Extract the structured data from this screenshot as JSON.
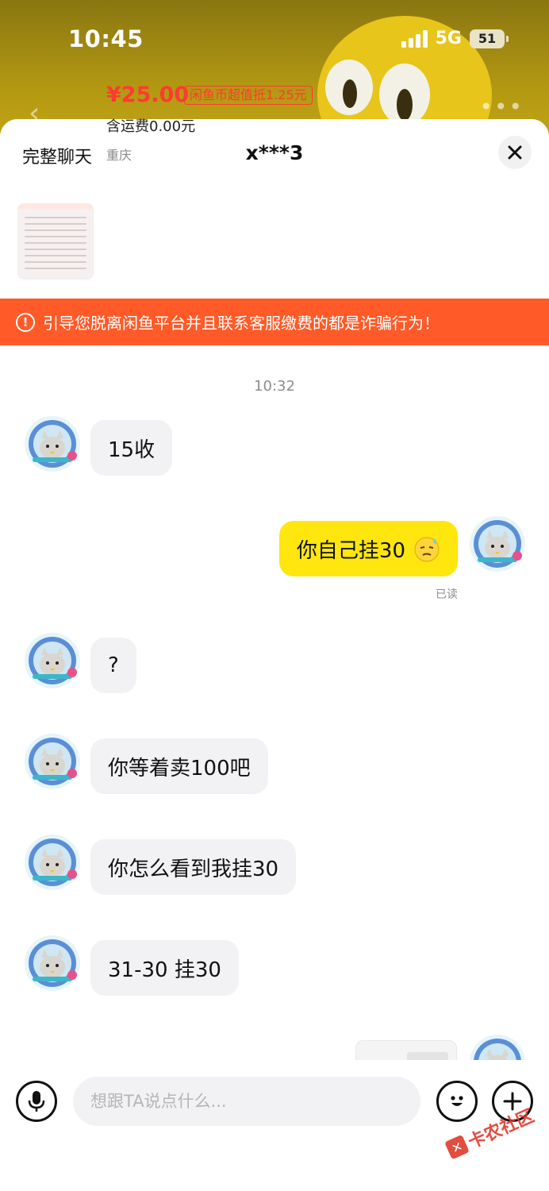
{
  "status_bar": {
    "time": "10:45",
    "network": "5G",
    "battery": "51"
  },
  "header": {
    "full_chat_label": "完整聊天",
    "peer_name": "x***3"
  },
  "product": {
    "price": "¥25.00",
    "coin_badge": "闲鱼币超值抵1.25元",
    "shipping": "含运费0.00元",
    "location": "重庆"
  },
  "warning": {
    "text": "引导您脱离闲鱼平台并且联系客服缴费的都是诈骗行为！"
  },
  "chat": {
    "timestamp": "10:32",
    "messages": [
      {
        "side": "left",
        "text": "15收"
      },
      {
        "side": "right",
        "text": "你自己挂30",
        "emoji": "sweat-face-emoji"
      },
      {
        "side": "left",
        "text": "?"
      },
      {
        "side": "left",
        "text": "你等着卖100吧"
      },
      {
        "side": "left",
        "text": "你怎么看到我挂30"
      },
      {
        "side": "left",
        "text": "31-30 挂30"
      }
    ],
    "read_status": "已读"
  },
  "input": {
    "placeholder": "想跟TA说点什么..."
  },
  "watermark": {
    "text": "卡农社区"
  },
  "colors": {
    "accent_yellow": "#ffe60f",
    "price_red": "#ff3b30",
    "warning_orange": "#ff5a28"
  },
  "icons": [
    "back-icon",
    "more-icon",
    "close-icon",
    "warning-icon",
    "microphone-icon",
    "emoji-icon",
    "plus-icon"
  ]
}
